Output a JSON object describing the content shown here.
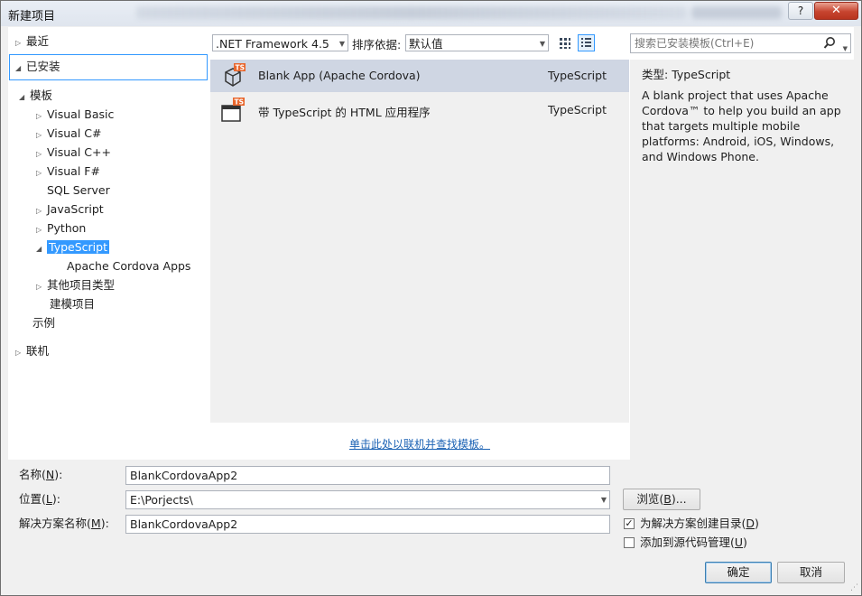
{
  "window": {
    "title": "新建项目",
    "help_label": "?",
    "close_label": "✕"
  },
  "tree": {
    "recent": "最近",
    "installed": "已安装",
    "templates": "模板",
    "languages": [
      "Visual Basic",
      "Visual C#",
      "Visual C++",
      "Visual F#",
      "SQL Server",
      "JavaScript",
      "Python"
    ],
    "selected": "TypeScript",
    "selected_child": "Apache Cordova Apps",
    "other_types": "其他项目类型",
    "modeling": "建模项目",
    "samples": "示例",
    "online": "联机"
  },
  "toolbar": {
    "framework": ".NET Framework 4.5",
    "sort_label": "排序依据:",
    "sort_value": "默认值"
  },
  "templates": [
    {
      "name": "Blank App (Apache Cordova)",
      "language": "TypeScript",
      "selected": true,
      "icon": "cordova-ts-icon"
    },
    {
      "name": "带 TypeScript 的 HTML 应用程序",
      "language": "TypeScript",
      "selected": false,
      "icon": "html-ts-icon"
    }
  ],
  "online_link": "单击此处以联机并查找模板。",
  "search": {
    "placeholder": "搜索已安装模板(Ctrl+E)"
  },
  "details": {
    "type_label": "类型:",
    "type_value": "TypeScript",
    "description": "A blank project that uses Apache Cordova™ to help you build an app that targets multiple mobile platforms: Android, iOS, Windows, and Windows Phone."
  },
  "form": {
    "name_label_pre": "名称(",
    "name_label_key": "N",
    "name_label_post": "):",
    "name_value": "BlankCordovaApp2",
    "location_label_pre": "位置(",
    "location_label_key": "L",
    "location_label_post": "):",
    "location_value": "E:\\Porjects\\",
    "solution_label_pre": "解决方案名称(",
    "solution_label_key": "M",
    "solution_label_post": "):",
    "solution_value": "BlankCordovaApp2",
    "browse_pre": "浏览(",
    "browse_key": "B",
    "browse_post": ")...",
    "create_dir_pre": "为解决方案创建目录(",
    "create_dir_key": "D",
    "create_dir_post": ")",
    "create_dir_checked": true,
    "source_control_pre": "添加到源代码管理(",
    "source_control_key": "U",
    "source_control_post": ")",
    "source_control_checked": false
  },
  "buttons": {
    "ok": "确定",
    "cancel": "取消"
  },
  "colors": {
    "selection": "#3399ff",
    "selected_row": "#cfd6e3",
    "link": "#1b62b4",
    "ts_badge": "#e9662c"
  }
}
